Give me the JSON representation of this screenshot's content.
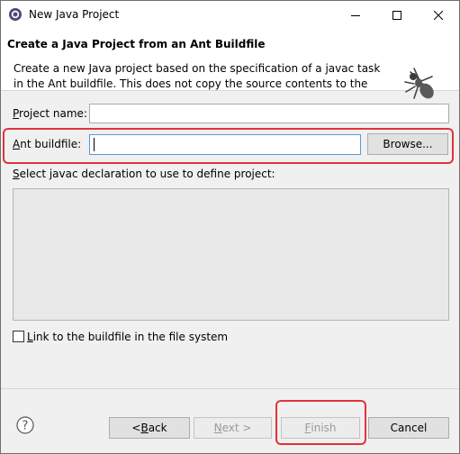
{
  "window": {
    "title": "New Java Project"
  },
  "header": {
    "title": "Create a Java Project from an Ant Buildfile",
    "description": "Create a new Java project based on the specification of a javac task in the Ant buildfile. This does not copy the source contents to the"
  },
  "form": {
    "project_name_label_accel": "P",
    "project_name_label_rest": "roject name:",
    "project_name_value": "",
    "ant_buildfile_label_accel": "A",
    "ant_buildfile_label_rest": "nt buildfile:",
    "ant_buildfile_value": "",
    "browse_label": "Browse...",
    "javac_label_accel": "S",
    "javac_label_rest": "elect javac declaration to use to define project:",
    "link_label_accel": "L",
    "link_label_rest": "ink to the buildfile in the file system",
    "link_checked": false
  },
  "footer": {
    "back_prefix": "< ",
    "back_accel": "B",
    "back_rest": "ack",
    "next_accel": "N",
    "next_rest": "ext >",
    "finish_accel": "F",
    "finish_rest": "inish",
    "cancel_label": "Cancel"
  },
  "colors": {
    "highlight": "#e0333c",
    "window_bg": "#f0f0f0",
    "header_bg": "#ffffff"
  },
  "icons": [
    "app-icon",
    "minimize-icon",
    "maximize-icon",
    "close-icon",
    "ant-icon",
    "help-icon"
  ]
}
